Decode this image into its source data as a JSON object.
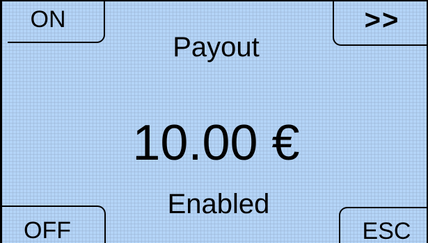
{
  "softkeys": {
    "top_left": "ON",
    "top_right": ">>",
    "bottom_left": "OFF",
    "bottom_right": "ESC"
  },
  "screen": {
    "title": "Payout",
    "amount": "10.00 €",
    "status": "Enabled"
  },
  "colors": {
    "display_background": "#b4d4f7",
    "grid_lines": "#96afcd",
    "text": "#000000"
  }
}
